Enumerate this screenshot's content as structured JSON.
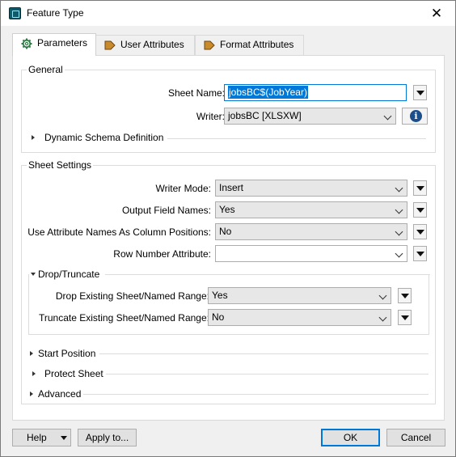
{
  "window": {
    "title": "Feature Type"
  },
  "tabs": [
    {
      "label": "Parameters",
      "icon": "gear-icon"
    },
    {
      "label": "User Attributes",
      "icon": "arrow-tag-icon"
    },
    {
      "label": "Format Attributes",
      "icon": "arrow-tag-icon"
    }
  ],
  "general": {
    "title": "General",
    "sheet_name_label": "Sheet Name:",
    "sheet_name_value": "jobsBC$(JobYear)",
    "writer_label": "Writer:",
    "writer_value": "jobsBC [XLSXW]",
    "dynamic_schema_label": "Dynamic Schema Definition"
  },
  "sheet_settings": {
    "title": "Sheet Settings",
    "writer_mode_label": "Writer Mode:",
    "writer_mode_value": "Insert",
    "output_field_names_label": "Output Field Names:",
    "output_field_names_value": "Yes",
    "use_attr_names_label": "Use Attribute Names As Column Positions:",
    "use_attr_names_value": "No",
    "row_number_attr_label": "Row Number Attribute:",
    "row_number_attr_value": "",
    "drop_truncate": {
      "title": "Drop/Truncate",
      "drop_label": "Drop Existing Sheet/Named Range:",
      "drop_value": "Yes",
      "truncate_label": "Truncate Existing Sheet/Named Range:",
      "truncate_value": "No"
    },
    "start_position_label": "Start Position",
    "protect_sheet_label": "Protect Sheet",
    "advanced_label": "Advanced"
  },
  "footer": {
    "help_label": "Help",
    "apply_label": "Apply to...",
    "ok_label": "OK",
    "cancel_label": "Cancel"
  },
  "colors": {
    "accent": "#0078d7",
    "info": "#1b4e8a"
  }
}
